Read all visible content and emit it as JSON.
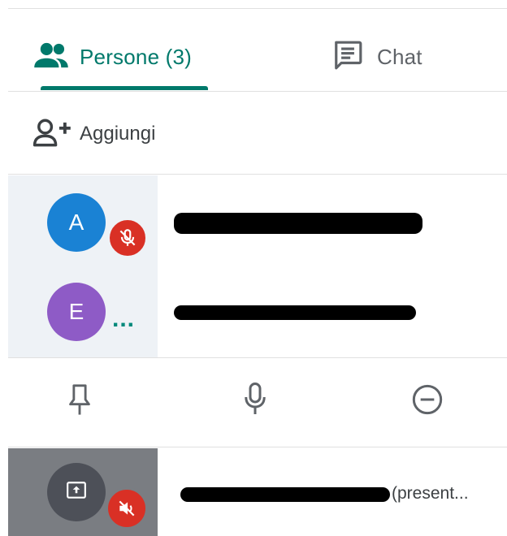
{
  "tabs": {
    "people_label": "Persone (3)",
    "chat_label": "Chat"
  },
  "add": {
    "label": "Aggiungi"
  },
  "participants": [
    {
      "initial": "A",
      "avatar_color": "#1a82d4",
      "status": "muted"
    },
    {
      "initial": "E",
      "avatar_color": "#8e5bc6",
      "status": "speaking"
    }
  ],
  "presentation": {
    "suffix": "(present..."
  },
  "colors": {
    "accent": "#00796b",
    "muted_red": "#d93025"
  },
  "icons": [
    "people-icon",
    "chat-icon",
    "person-add-icon",
    "mic-off-icon",
    "more-dots-icon",
    "pin-icon",
    "mic-icon",
    "remove-circle-icon",
    "present-screen-icon",
    "volume-off-icon"
  ]
}
